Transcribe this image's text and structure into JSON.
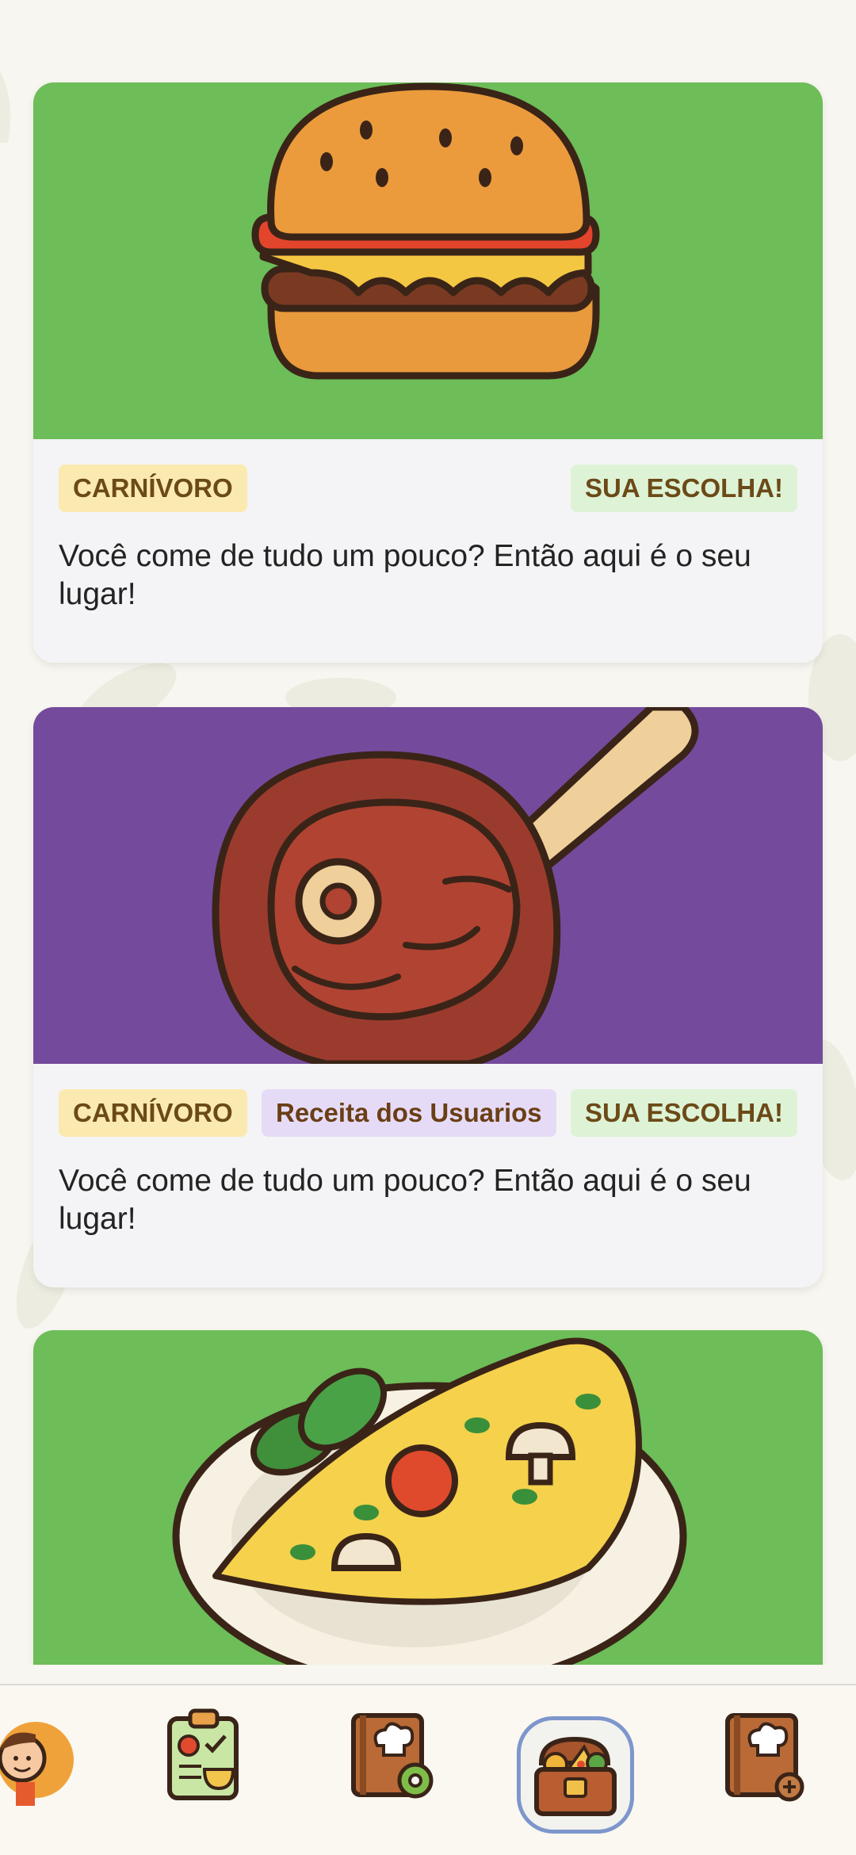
{
  "feed": {
    "cards": [
      {
        "image_icon": "hamburger-icon",
        "image_bg": "#6dbd58",
        "tags": {
          "left": "CARNÍVORO",
          "right": "SUA ESCOLHA!"
        },
        "description": "Você come de tudo um pouco? Então aqui é o seu lugar!"
      },
      {
        "image_icon": "steak-icon",
        "image_bg": "#744b9c",
        "tags": {
          "left": "CARNÍVORO",
          "middle": "Receita dos Usuarios",
          "right": "SUA ESCOLHA!"
        },
        "description": "Você come de tudo um pouco? Então aqui é o seu lugar!"
      },
      {
        "image_icon": "omelette-icon",
        "image_bg": "#6dbd58"
      }
    ]
  },
  "bottom_nav": {
    "items": [
      {
        "icon": "chef-avatar-icon"
      },
      {
        "icon": "meal-plan-clipboard-icon"
      },
      {
        "icon": "recipe-book-settings-icon"
      },
      {
        "icon": "food-treasure-chest-icon",
        "selected": true
      },
      {
        "icon": "add-recipe-book-icon"
      }
    ],
    "selected_color": "#7d96cc"
  }
}
